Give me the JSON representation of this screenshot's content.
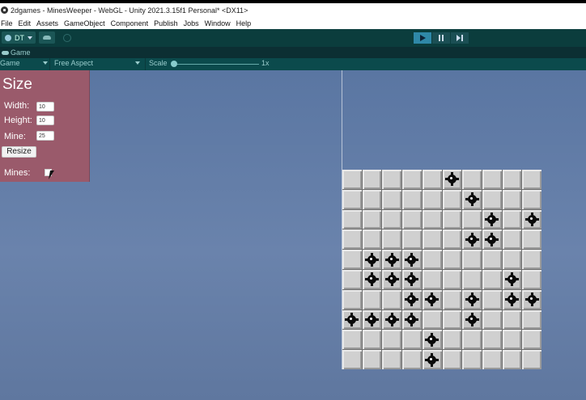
{
  "window": {
    "title": "2dgames - MinesWeeper - WebGL - Unity 2021.3.15f1 Personal* <DX11>"
  },
  "menu": [
    "File",
    "Edit",
    "Assets",
    "GameObject",
    "Component",
    "Publish",
    "Jobs",
    "Window",
    "Help"
  ],
  "toolbar": {
    "account_label": "DT"
  },
  "game_tab": {
    "label": "Game"
  },
  "game_bar": {
    "display": "Game",
    "aspect": "Free Aspect",
    "scale_label": "Scale",
    "scale_value": "1x"
  },
  "panel": {
    "title": "Size",
    "width_label": "Width:",
    "width_value": "10",
    "height_label": "Height:",
    "height_value": "10",
    "mine_label": "Mine:",
    "mine_value": "25",
    "resize_label": "Resize",
    "mines_label": "Mines:",
    "mines_checked": false
  },
  "board": {
    "columns": 10,
    "rows": 10,
    "mines": [
      [
        0,
        5
      ],
      [
        1,
        6
      ],
      [
        2,
        7
      ],
      [
        2,
        9
      ],
      [
        3,
        6
      ],
      [
        3,
        7
      ],
      [
        4,
        1
      ],
      [
        4,
        2
      ],
      [
        4,
        3
      ],
      [
        5,
        1
      ],
      [
        5,
        2
      ],
      [
        5,
        3
      ],
      [
        5,
        8
      ],
      [
        6,
        3
      ],
      [
        6,
        4
      ],
      [
        6,
        6
      ],
      [
        6,
        8
      ],
      [
        6,
        9
      ],
      [
        7,
        0
      ],
      [
        7,
        1
      ],
      [
        7,
        2
      ],
      [
        7,
        3
      ],
      [
        7,
        6
      ],
      [
        8,
        4
      ],
      [
        9,
        4
      ]
    ]
  }
}
